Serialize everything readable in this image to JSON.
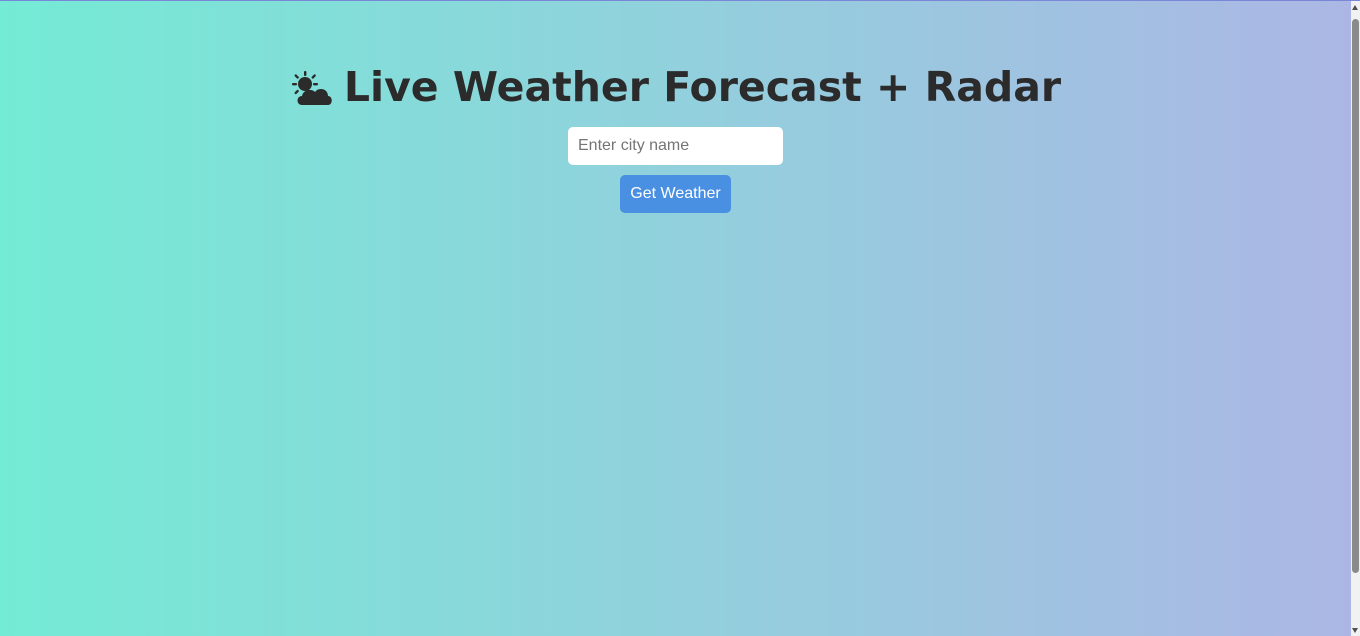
{
  "header": {
    "icon": "sun-behind-cloud-icon",
    "title": "Live Weather Forecast + Radar"
  },
  "search": {
    "placeholder": "Enter city name",
    "value": ""
  },
  "actions": {
    "get_weather_label": "Get Weather"
  },
  "colors": {
    "gradient_start": "#74ebd5",
    "gradient_end": "#acb6e5",
    "title_text": "#2b2b2b",
    "button_bg": "#4a90e2",
    "button_text": "#ffffff"
  }
}
